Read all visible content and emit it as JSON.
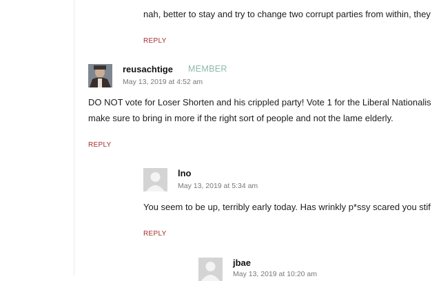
{
  "comments": [
    {
      "text_lines": [
        "nah, better to stay and try to change two corrupt parties from within, they"
      ],
      "reply_label": "REPLY"
    },
    {
      "author": "reusachtige",
      "badge": "MEMBER",
      "date": "May 13, 2019 at 4:52 am",
      "avatar": "user-photo",
      "text_lines": [
        "DO NOT vote for Loser Shorten and his crippled party! Vote 1 for the Liberal Nationalis",
        "make sure to bring in more if the right sort of people and not the lame elderly."
      ],
      "reply_label": "REPLY"
    },
    {
      "author": "lno",
      "date": "May 13, 2019 at 5:34 am",
      "avatar": "default-avatar-icon",
      "text_lines": [
        "You seem to be up, terribly early today. Has wrinkly p*ssy scared you stif"
      ],
      "reply_label": "REPLY"
    },
    {
      "author": "jbae",
      "date": "May 13, 2019 at 10:20 am",
      "avatar": "default-avatar-icon"
    }
  ],
  "colors": {
    "reply": "#a52a2a",
    "badge": "#8fb9a8",
    "date": "#777777"
  }
}
